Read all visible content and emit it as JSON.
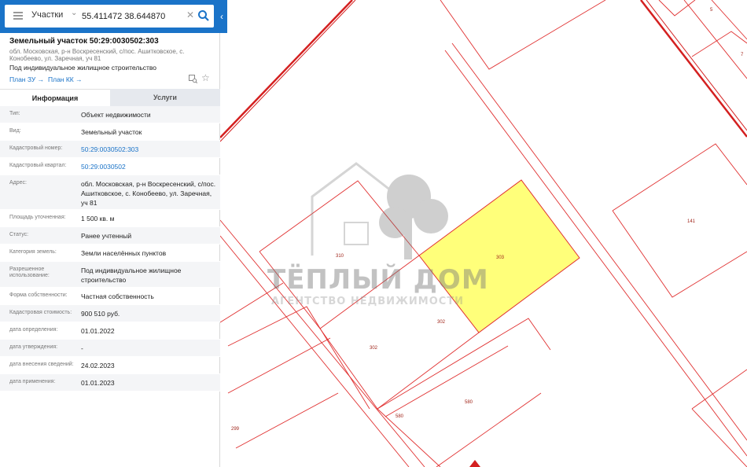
{
  "search": {
    "layer": "Участки",
    "coordinates": "55.411472 38.644870"
  },
  "header": {
    "title": "Земельный участок 50:29:0030502:303",
    "address_sub": "обл. Московская, р-н Воскресенский, с/пос. Ашитковское, с. Конобеево, ул. Заречная, уч 81",
    "purpose": "Под индивидуальное жилищное строительство",
    "plan_zu": "План ЗУ →",
    "plan_kk": "План КК →"
  },
  "tabs": {
    "info": "Информация",
    "services": "Услуги"
  },
  "info": [
    {
      "label": "Тип:",
      "value": "Объект недвижимости",
      "link": false
    },
    {
      "label": "Вид:",
      "value": "Земельный участок",
      "link": false
    },
    {
      "label": "Кадастровый номер:",
      "value": "50:29:0030502:303",
      "link": true
    },
    {
      "label": "Кадастровый квартал:",
      "value": "50:29:0030502",
      "link": true
    },
    {
      "label": "Адрес:",
      "value": "обл. Московская, р-н Воскресенский, с/пос. Ашитковское, с. Конобеево, ул. Заречная, уч 81",
      "link": false
    },
    {
      "label": "Площадь уточненная:",
      "value": "1 500 кв. м",
      "link": false
    },
    {
      "label": "Статус:",
      "value": "Ранее учтенный",
      "link": false
    },
    {
      "label": "Категория земель:",
      "value": "Земли населённых пунктов",
      "link": false
    },
    {
      "label": "Разрешенное использование:",
      "value": "Под индивидуальное жилищное строительство",
      "link": false
    },
    {
      "label": "Форма собственности:",
      "value": "Частная собственность",
      "link": false
    },
    {
      "label": "Кадастровая стоимость:",
      "value": "900 510 руб.",
      "link": false
    },
    {
      "label": "дата определения:",
      "value": "01.01.2022",
      "link": false
    },
    {
      "label": "дата утверждения:",
      "value": "-",
      "link": false
    },
    {
      "label": "дата внесения сведений:",
      "value": "24.02.2023",
      "link": false
    },
    {
      "label": "дата применения:",
      "value": "01.01.2023",
      "link": false
    }
  ],
  "map": {
    "parcel_labels": [
      "5",
      "7",
      "141",
      "310",
      "303",
      "302",
      "302",
      "580",
      "580",
      "299"
    ],
    "selected_color": "#ffff7a",
    "boundary_color": "#e03030"
  },
  "watermark": {
    "title": "ТЁПЛЫЙ ДОМ",
    "subtitle": "АГЕНТСТВО НЕДВИЖИМОСТИ"
  }
}
